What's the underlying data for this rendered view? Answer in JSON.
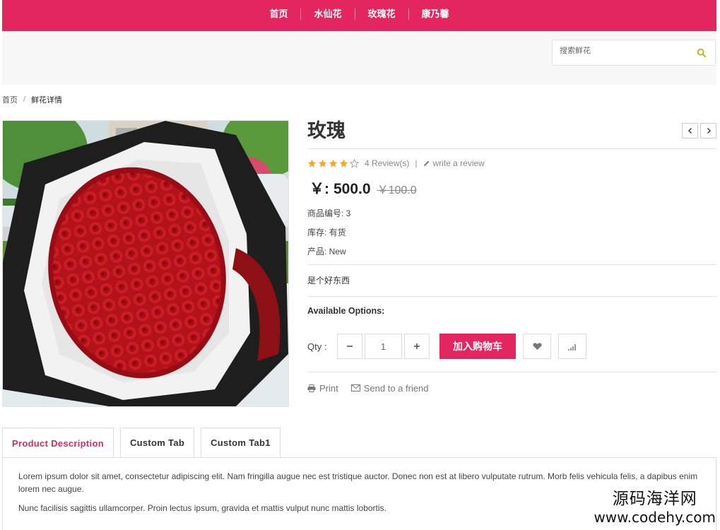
{
  "nav": {
    "items": [
      "首页",
      "水仙花",
      "玫瑰花",
      "康乃馨"
    ]
  },
  "search": {
    "placeholder": "搜索鲜花"
  },
  "breadcrumb": {
    "home": "首页",
    "separator": "/",
    "current": "鲜花详情"
  },
  "product": {
    "title": "玫瑰",
    "rating": 4,
    "rating_max": 5,
    "reviews_label": "4 Review(s)",
    "write_review_label": "write a review",
    "price_prefix": "￥:",
    "price": "500.0",
    "old_price": "￥100.0",
    "code_label": "商品编号: 3",
    "stock_label": "库存: 有货",
    "product_label": "产品: New",
    "short_description": "是个好东西",
    "available_options_label": "Available Options:",
    "qty_label": "Qty :",
    "qty_value": "1",
    "add_to_cart_label": "加入购物车",
    "print_label": "Print",
    "send_friend_label": "Send to a friend"
  },
  "tabs": [
    {
      "label": "Product Description",
      "active": true
    },
    {
      "label": "Custom Tab",
      "active": false
    },
    {
      "label": "Custom Tab1",
      "active": false
    }
  ],
  "description": {
    "paragraph1": "Lorem ipsum dolor sit amet, consectetur adipiscing elit. Nam fringilla augue nec est tristique auctor. Donec non est at libero vulputate rutrum. Morb felis vehicula felis, a dapibus enim lorem nec augue.",
    "paragraph2": "Nunc facilisis sagittis ullamcorper. Proin lectus ipsum, gravida et mattis vulput nunc mattis lobortis."
  },
  "watermark": {
    "line1": "源码海洋网",
    "line2": "www.codehy.com"
  },
  "colors": {
    "accent": "#e32660",
    "star": "#f5a623",
    "search_icon": "#b8b800"
  },
  "icons": {
    "search": "search-icon",
    "prev": "chevron-left-icon",
    "next": "chevron-right-icon",
    "pencil": "pencil-icon",
    "heart": "heart-icon",
    "compare": "bar-chart-icon",
    "print": "printer-icon",
    "envelope": "envelope-icon"
  }
}
